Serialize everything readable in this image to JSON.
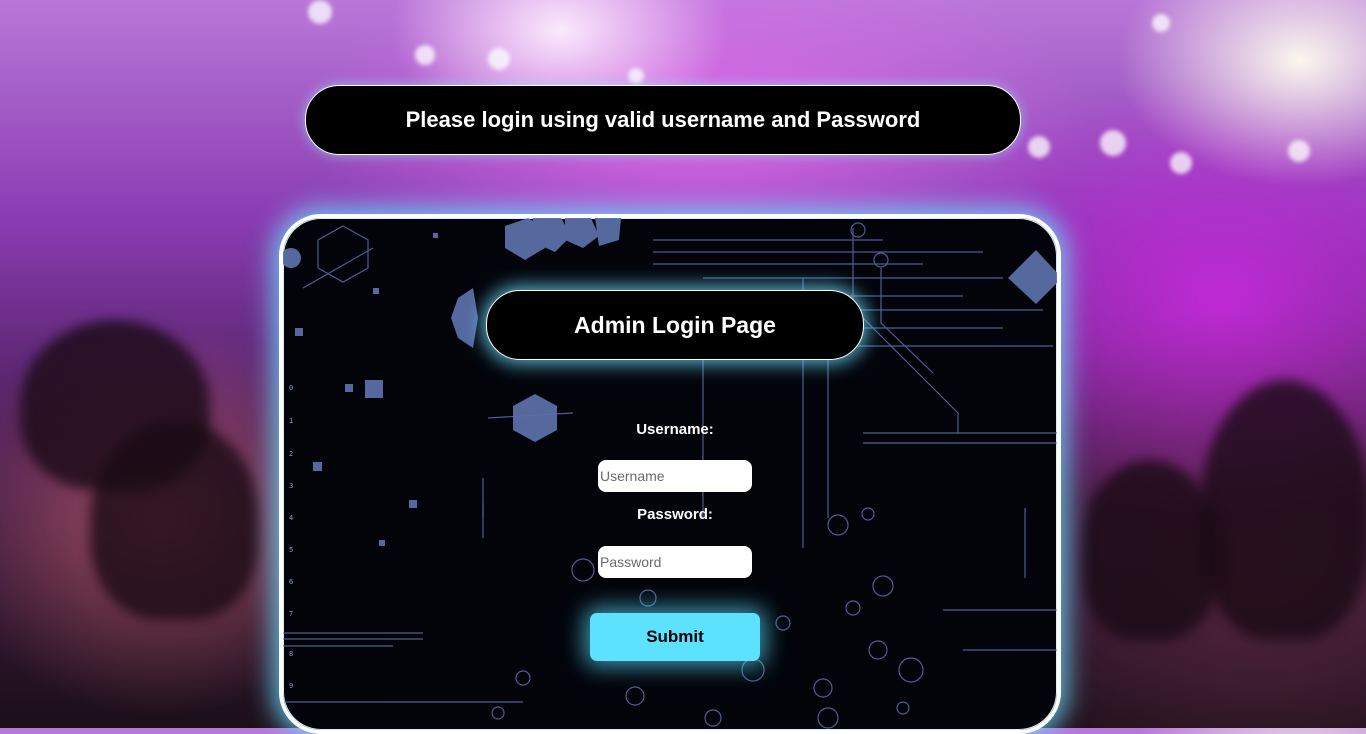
{
  "notice": {
    "text": "Please login using valid username and Password"
  },
  "login": {
    "title": "Admin Login Page",
    "username_label": "Username:",
    "username_placeholder": "Username",
    "username_value": "",
    "password_label": "Password:",
    "password_placeholder": "Password",
    "password_value": "",
    "submit_label": "Submit"
  },
  "deco_numbers": [
    "0",
    "1",
    "2",
    "3",
    "4",
    "5",
    "6",
    "7",
    "8",
    "9"
  ],
  "colors": {
    "accent": "#5ce1ff",
    "panel_bg": "#02040a",
    "deco": "#5a6fa8"
  }
}
